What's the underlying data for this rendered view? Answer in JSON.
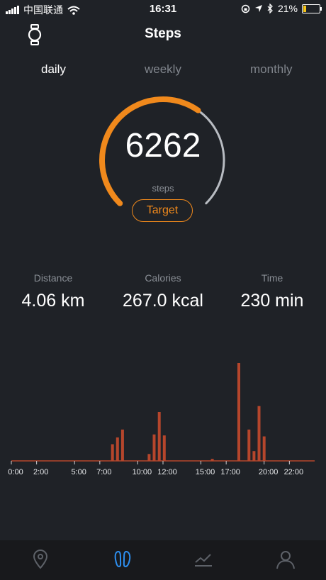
{
  "status_bar": {
    "carrier": "中国联通",
    "time": "16:31",
    "battery_percent": "21%",
    "battery_level": 0.21,
    "battery_color": "#f5c518",
    "icons": [
      "signal-icon",
      "wifi-icon",
      "lock-rotation-icon",
      "location-icon",
      "bluetooth-icon",
      "battery-icon"
    ]
  },
  "header": {
    "title": "Steps",
    "left_icon": "watch-icon"
  },
  "tabs": [
    {
      "label": "daily",
      "active": true
    },
    {
      "label": "weekly",
      "active": false
    },
    {
      "label": "monthly",
      "active": false
    }
  ],
  "ring": {
    "value": "6262",
    "unit": "steps",
    "target_label": "Target",
    "progress": 0.63,
    "accent_color": "#f0891c",
    "track_color": "#b8bcc2"
  },
  "stats": [
    {
      "label": "Distance",
      "value": "4.06 km"
    },
    {
      "label": "Calories",
      "value": "267.0 kcal"
    },
    {
      "label": "Time",
      "value": "230 min"
    }
  ],
  "chart_data": {
    "type": "bar",
    "bar_color": "#b5462c",
    "x_range": [
      0,
      24
    ],
    "tick_labels": [
      "0:00",
      "2:00",
      "5:00",
      "7:00",
      "10:00",
      "12:00",
      "15:00",
      "17:00",
      "20:00",
      "22:00"
    ],
    "tick_hours": [
      0,
      2,
      5,
      7,
      10,
      12,
      15,
      17,
      20,
      22
    ],
    "ymax": 1.0,
    "bars": [
      {
        "x": 8.0,
        "y": 0.17
      },
      {
        "x": 8.4,
        "y": 0.24
      },
      {
        "x": 8.8,
        "y": 0.32
      },
      {
        "x": 10.9,
        "y": 0.07
      },
      {
        "x": 11.3,
        "y": 0.27
      },
      {
        "x": 11.7,
        "y": 0.5
      },
      {
        "x": 12.1,
        "y": 0.26
      },
      {
        "x": 15.9,
        "y": 0.02
      },
      {
        "x": 18.0,
        "y": 1.0
      },
      {
        "x": 18.8,
        "y": 0.32
      },
      {
        "x": 19.2,
        "y": 0.1
      },
      {
        "x": 19.6,
        "y": 0.56
      },
      {
        "x": 20.0,
        "y": 0.25
      }
    ]
  },
  "tabbar": {
    "items": [
      {
        "icon": "location-pin-icon",
        "active": false
      },
      {
        "icon": "footprints-icon",
        "active": true
      },
      {
        "icon": "trend-icon",
        "active": false
      },
      {
        "icon": "profile-icon",
        "active": false
      }
    ],
    "active_color": "#2d8ff0",
    "inactive_color": "#5d6168"
  }
}
